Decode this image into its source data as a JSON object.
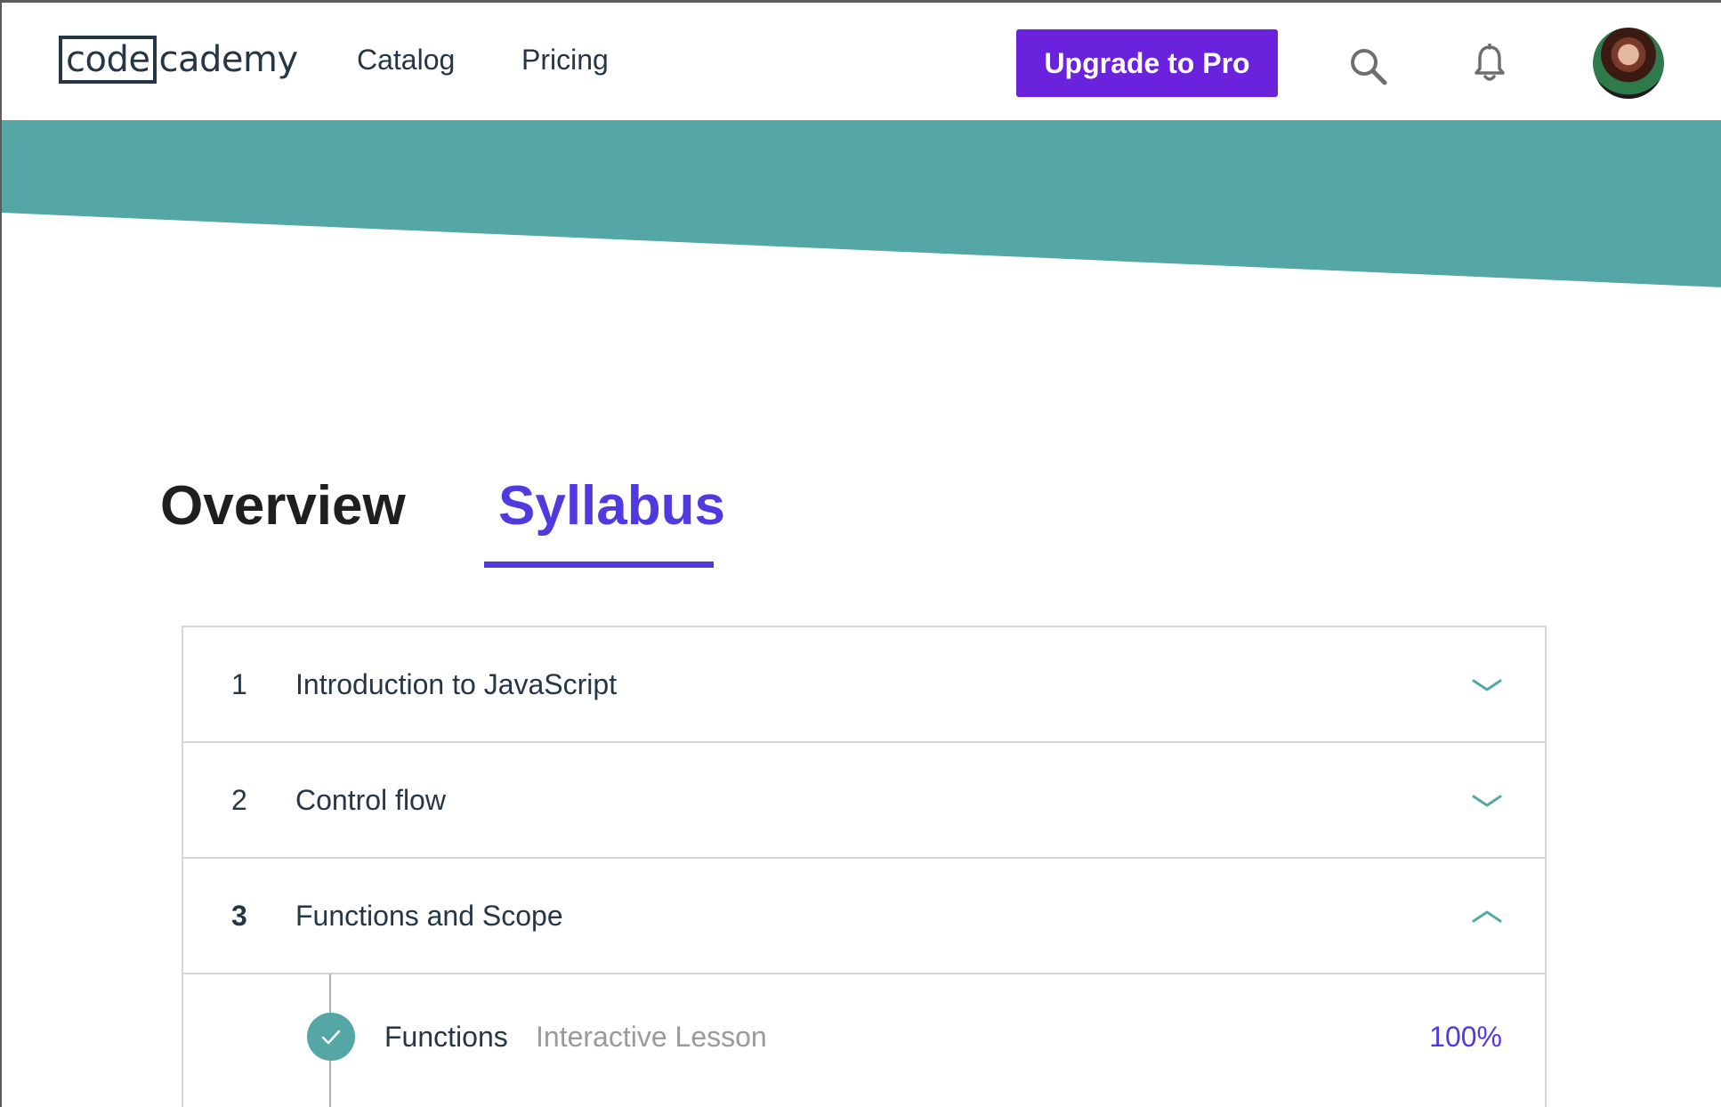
{
  "nav": {
    "logo_boxed": "code",
    "logo_rest": "cademy",
    "links": [
      {
        "label": "Catalog"
      },
      {
        "label": "Pricing"
      }
    ],
    "upgrade_label": "Upgrade to Pro",
    "icons": [
      "search-icon",
      "bell-icon"
    ]
  },
  "banner": {
    "color": "#55a7a5"
  },
  "tabs": [
    {
      "label": "Overview",
      "active": false
    },
    {
      "label": "Syllabus",
      "active": true
    }
  ],
  "colors": {
    "accent": "#4f3ae0",
    "upgrade": "#6a22dc",
    "teal": "#55a7a5",
    "text": "#253746"
  },
  "syllabus": {
    "modules": [
      {
        "number": "1",
        "title": "Introduction to JavaScript",
        "expanded": false,
        "chevron": "chevron-down-icon"
      },
      {
        "number": "2",
        "title": "Control flow",
        "expanded": false,
        "chevron": "chevron-down-icon"
      },
      {
        "number": "3",
        "title": "Functions and Scope",
        "expanded": true,
        "chevron": "chevron-up-icon"
      }
    ],
    "lessons": [
      {
        "title": "Functions",
        "type": "Interactive Lesson",
        "progress": "100%",
        "completed": true,
        "icon": "check-circle-icon"
      }
    ]
  }
}
